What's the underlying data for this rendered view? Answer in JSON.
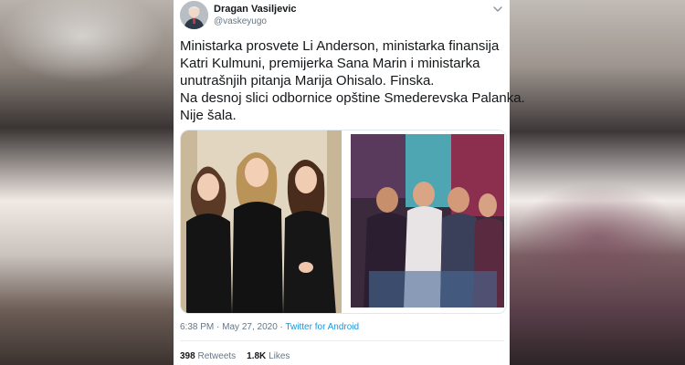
{
  "tweet": {
    "author_name": "Dragan Vasiljevic",
    "author_handle": "@vaskeyugo",
    "text_lines": [
      "Ministarka prosvete Li Anderson, ministarka finansija",
      "Katri Kulmuni, premijerka Sana Marin i ministarka",
      "unutrašnjih pitanja Marija Ohisalo. Finska.",
      "Na desnoj slici odbornice opštine Smederevska Palanka.",
      "Nije šala."
    ],
    "time": "6:38 PM",
    "date": "May 27, 2020",
    "separator": "·",
    "source": "Twitter for Android",
    "retweets_count": "398",
    "retweets_label": "Retweets",
    "likes_count": "1.8K",
    "likes_label": "Likes"
  },
  "icons": {
    "menu": "chevron-down-icon",
    "avatar": "avatar"
  },
  "colors": {
    "link": "#1b95e0",
    "text": "#14171a",
    "muted": "#657786",
    "background": "#ffffff"
  }
}
